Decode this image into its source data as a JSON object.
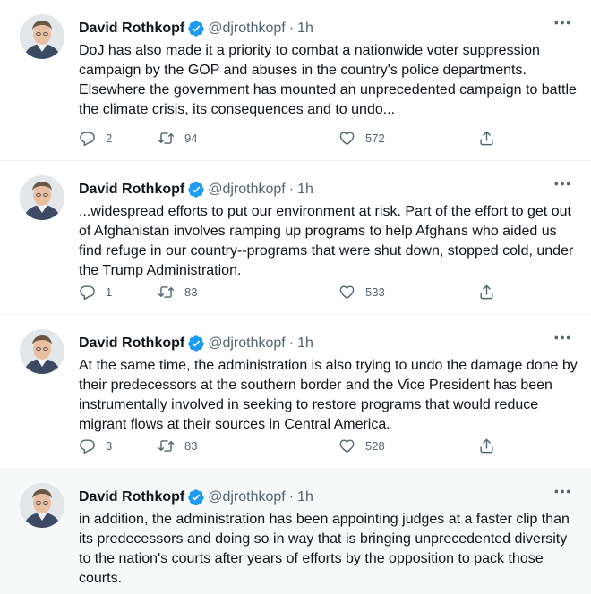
{
  "tweets": [
    {
      "author": "David Rothkopf",
      "handle": "@djrothkopf",
      "separator": "·",
      "time": "1h",
      "text": "DoJ has also made it a priority to combat a nationwide voter suppression campaign by the GOP and abuses in the country's police departments. Elsewhere the government has mounted an unprecedented campaign to battle the climate crisis, its consequences and to undo...",
      "replies": "2",
      "retweets": "94",
      "likes": "572"
    },
    {
      "author": "David Rothkopf",
      "handle": "@djrothkopf",
      "separator": "·",
      "time": "1h",
      "text": "...widespread efforts to put our environment at risk. Part of the effort to get out of Afghanistan involves ramping up programs to help Afghans who aided us find refuge in our country--programs that were shut down, stopped cold, under the Trump Administration.",
      "replies": "1",
      "retweets": "83",
      "likes": "533"
    },
    {
      "author": "David Rothkopf",
      "handle": "@djrothkopf",
      "separator": "·",
      "time": "1h",
      "text": "At the same time, the administration is also trying to undo the damage done by their predecessors at the southern border and the Vice President has been instrumentally involved in seeking to restore programs that would reduce migrant flows at their sources in Central America.",
      "replies": "3",
      "retweets": "83",
      "likes": "528"
    },
    {
      "author": "David Rothkopf",
      "handle": "@djrothkopf",
      "separator": "·",
      "time": "1h",
      "text": "in addition, the administration has been appointing judges at a faster clip than its predecessors and doing so in way that is bringing unprecedented diversity to the nation's courts after years of efforts by the opposition to pack those courts."
    }
  ],
  "icons": {
    "verified": "verified-badge-icon",
    "more": "more-icon",
    "reply": "reply-icon",
    "retweet": "retweet-icon",
    "like": "like-icon",
    "share": "share-icon"
  },
  "colors": {
    "verified": "#1d9bf0",
    "secondary_text": "#536471",
    "highlight_bg": "#f7f9f9"
  }
}
